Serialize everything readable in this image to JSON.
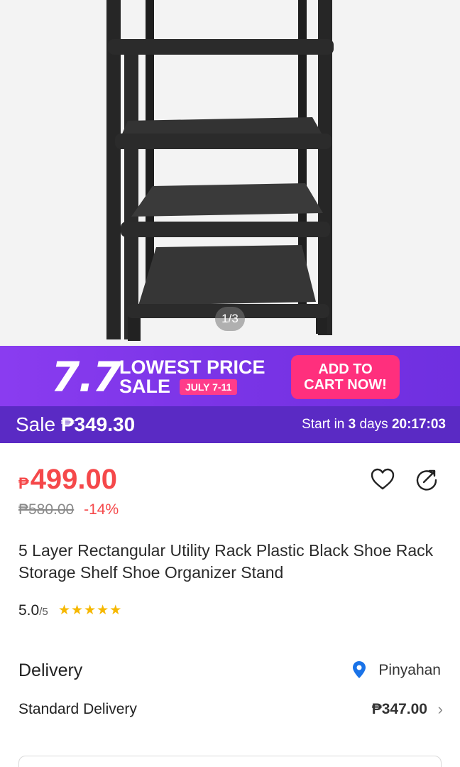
{
  "gallery": {
    "indicator": "1/3"
  },
  "promo": {
    "number": "7.7",
    "title": "LOWEST PRICE",
    "sale_word": "SALE",
    "dates": "JULY 7-11",
    "cta_line1": "ADD TO",
    "cta_line2": "CART NOW!"
  },
  "sale_strip": {
    "label": "Sale",
    "price": "₱349.30",
    "start_prefix": "Start in",
    "start_days": "3",
    "start_days_word": "days",
    "timer": "20:17:03"
  },
  "price": {
    "currency": "₱",
    "value": "499.00",
    "original": "₱580.00",
    "discount": "-14%"
  },
  "product": {
    "title": "5 Layer Rectangular Utility Rack Plastic Black Shoe Rack Storage Shelf Shoe Organizer Stand"
  },
  "rating": {
    "score": "5.0",
    "out_of": "/5",
    "stars": 5
  },
  "delivery": {
    "heading": "Delivery",
    "location": "Pinyahan",
    "method": "Standard Delivery",
    "fee": "₱347.00"
  },
  "icons": {
    "wishlist": "heart-icon",
    "share": "share-icon",
    "location": "location-pin-icon",
    "chevron": "chevron-right-icon"
  },
  "colors": {
    "price": "#f5484a",
    "promo_bg": "#7a34e6",
    "sale_strip_bg": "#5a2ac4",
    "cta_bg": "#ff2f7d",
    "stars": "#f6b800",
    "pin": "#1a73e8"
  }
}
